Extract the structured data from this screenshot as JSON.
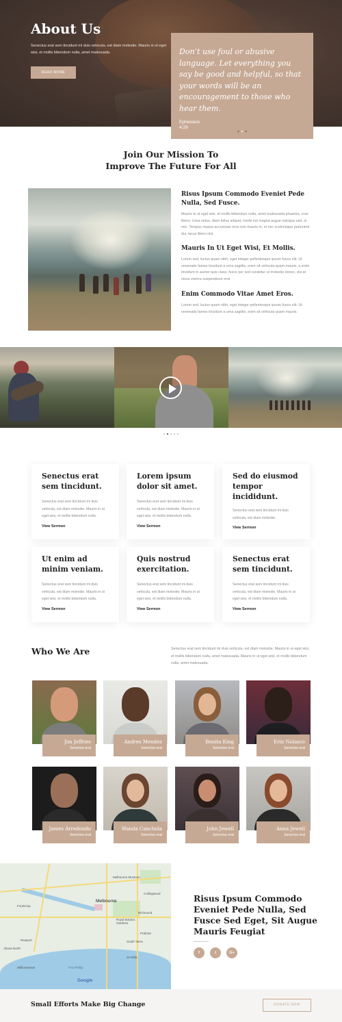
{
  "hero": {
    "title": "About Us",
    "text": "Senectus erat sem tincidunt mi duis vehicula, est diam molestie. Mauris in ut eget wisi, et mollis bibendum nulla, amet malesuada.",
    "button": "READ MORE",
    "quote": "Don’t use foul or abusive language. Let everything you say be good and helpful, so that your words will be an encouragement to those who hear them.",
    "quote_ref_line1": "Ephesians",
    "quote_ref_line2": "4:29"
  },
  "mission": {
    "title_line1": "Join Our Mission To",
    "title_line2": "Improve The Future For All",
    "items": [
      {
        "heading": "Risus Ipsum Commodo Eveniet Pede Nulla, Sed Fusce.",
        "text": "Mauris in ut eget wisi, et mollis bibendum nulla, amet malesuada pharetra, cras libero. Urna netus, diam tellus aliquet, morbi est magna augue natoque sed, in nec. Tempus massa accumsan eros non mauris in, et nec scelerisque parturient dui, lacus libero nisl."
      },
      {
        "heading": "Mauris In Ut Eget Wisi, Et Mollis.",
        "text": "Lorem sed, luctus quam nibh, eget integer pellentesque ipsum fusce elit. Ut venenatis fames tincidunt a urna sagittis, enim sit vehicula quam mauris, a enim tincidunt in auctor quis class, fusce per sed curabitur ut molestie donec, dui at nisus viverra suspendisse erat"
      },
      {
        "heading": "Enim Commodo Vitae Amet Eros.",
        "text": "Lorem sed, luctus quam nibh, eget integer pellentesque ipsum fusce elit. Ut venenatis fames tincidunt a urna sagittis, enim sit vehicula quam mauris."
      }
    ]
  },
  "sermons": [
    {
      "title": "Senectus erat sem tincidunt.",
      "text": "Senectus erat sem tincidunt mi duis vehicula, est diam molestie. Mauris in ut eget wisi, et mollis bibendum nulla.",
      "link": "View Sermon"
    },
    {
      "title": "Lorem ipsum dolor sit amet.",
      "text": "Senectus erat sem tincidunt mi duis vehicula, est diam molestie. Mauris in ut eget wisi, et mollis bibendum nulla.",
      "link": "View Sermon"
    },
    {
      "title": "Sed do eiusmod tempor incididunt.",
      "text": "Senectus erat sem tincidunt mi duis vehicula, est diam molestie.",
      "link": "View Sermon"
    },
    {
      "title": "Ut enim ad minim veniam.",
      "text": "Senectus erat sem tincidunt mi duis vehicula, est diam molestie. Mauris in ut eget wisi, et mollis bibendum nulla.",
      "link": "View Sermon"
    },
    {
      "title": "Quis nostrud exercitation.",
      "text": "Senectus erat sem tincidunt mi duis vehicula, est diam molestie. Mauris in ut eget wisi, et mollis bibendum nulla.",
      "link": "View Sermon"
    },
    {
      "title": "Senectus erat sem tincidunt.",
      "text": "Senectus erat sem tincidunt mi duis vehicula, est diam molestie. Mauris in ut eget wisi, et mollis bibendum nulla.",
      "link": "View Sermon"
    }
  ],
  "who": {
    "title": "Who We Are",
    "text": "Senectus erat sem tincidunt mi duis vehicula, est diam molestie. Mauris in ut eget wisi, et mollis bibendum nulla, amet malesuada. Mauris in ut eget wisi, et mollis bibendum nulla, amet malesuada."
  },
  "team": [
    {
      "name": "Jim Jeffries",
      "role": "Senectus erat"
    },
    {
      "name": "Andres Mendez",
      "role": "Senectus erat"
    },
    {
      "name": "Bonita King",
      "role": "Senectus erat"
    },
    {
      "name": "Erin Nolasco",
      "role": "Senectus erat"
    },
    {
      "name": "James Arredondo",
      "role": "Senectus erat"
    },
    {
      "name": "Wanda Canchola",
      "role": "Senectus erat"
    },
    {
      "name": "John Jewell",
      "role": "Senectus erat"
    },
    {
      "name": "Anna Jewell",
      "role": "Senectus erat"
    }
  ],
  "map": {
    "labels": [
      "Melbourne",
      "Melbourne Museum",
      "Collingwood",
      "Richmond",
      "Royal Botanic Gardens",
      "Prahran",
      "South Yarra",
      "St Kilda",
      "Williamstown",
      "Newport",
      "Altona North",
      "Footscray",
      "Port Phillip",
      "Google"
    ]
  },
  "contact": {
    "title": "Risus Ipsum Commodo Eveniet Pede Nulla, Sed Fusce Sed Eget, Sit Augue Mauris Feugiat",
    "social": [
      "f",
      "t",
      "G+"
    ]
  },
  "cta": {
    "text": "Small Efforts Make Big Change",
    "button": "DONATE NOW"
  },
  "colors": {
    "accent": "#c6a994",
    "dark": "#222222",
    "muted": "#8a8a8a"
  }
}
